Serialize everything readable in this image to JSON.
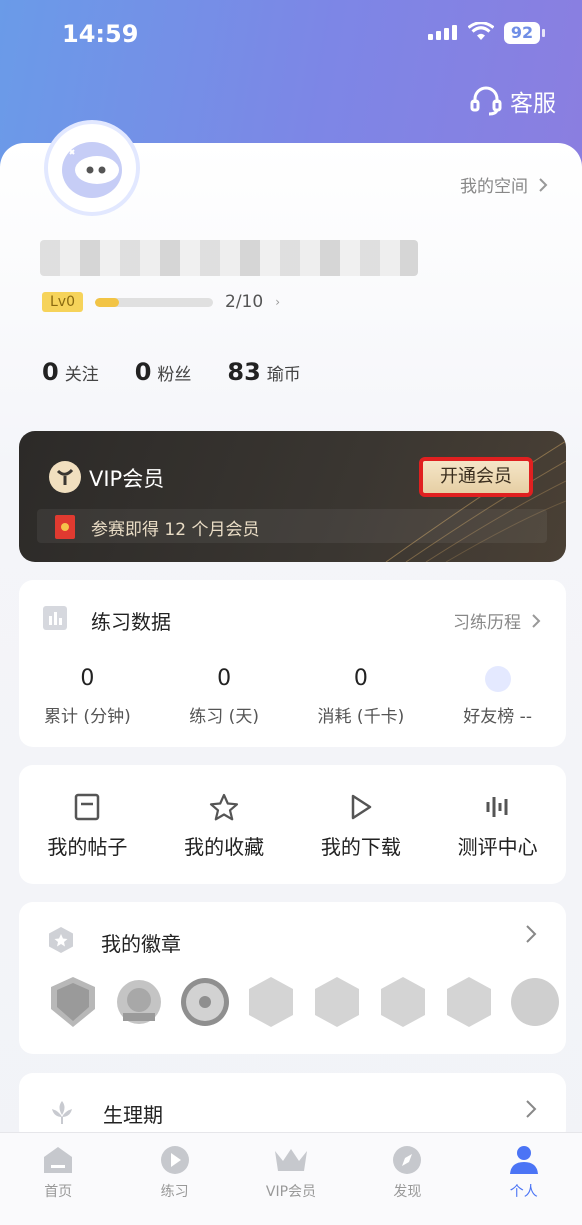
{
  "status_bar": {
    "time": "14:59",
    "battery": "92"
  },
  "header": {
    "service_label": "客服"
  },
  "profile": {
    "my_space_label": "我的空间",
    "level_badge": "Lv0",
    "level_progress": 0.2,
    "level_count": "2/10",
    "stats": [
      {
        "value": "0",
        "label": "关注"
      },
      {
        "value": "0",
        "label": "粉丝"
      },
      {
        "value": "83",
        "label": "瑜币"
      }
    ]
  },
  "vip": {
    "title": "VIP会员",
    "open_button": "开通会员",
    "promo_text": "参赛即得 12 个月会员"
  },
  "practice": {
    "title": "练习数据",
    "history_label": "习练历程",
    "stats": [
      {
        "value": "0",
        "label": "累计 (分钟)"
      },
      {
        "value": "0",
        "label": "练习 (天)"
      },
      {
        "value": "0",
        "label": "消耗 (千卡)"
      },
      {
        "value": "",
        "label": "好友榜 --"
      }
    ]
  },
  "quick_actions": [
    {
      "label": "我的帖子",
      "icon": "document-icon"
    },
    {
      "label": "我的收藏",
      "icon": "star-icon"
    },
    {
      "label": "我的下载",
      "icon": "play-triangle-icon"
    },
    {
      "label": "测评中心",
      "icon": "sound-bars-icon"
    }
  ],
  "badges": {
    "title": "我的徽章",
    "count_shown": 8
  },
  "period": {
    "title": "生理期"
  },
  "tab_bar": [
    {
      "label": "首页",
      "icon": "home-icon"
    },
    {
      "label": "练习",
      "icon": "play-circle-icon"
    },
    {
      "label": "VIP会员",
      "icon": "crown-icon"
    },
    {
      "label": "发现",
      "icon": "compass-icon"
    },
    {
      "label": "个人",
      "icon": "person-icon",
      "active": true
    }
  ],
  "colors": {
    "accent": "#4b74f5",
    "header_gradient_start": "#6a9be8",
    "header_gradient_end": "#8b7ee0",
    "highlight_border": "#e02020"
  }
}
